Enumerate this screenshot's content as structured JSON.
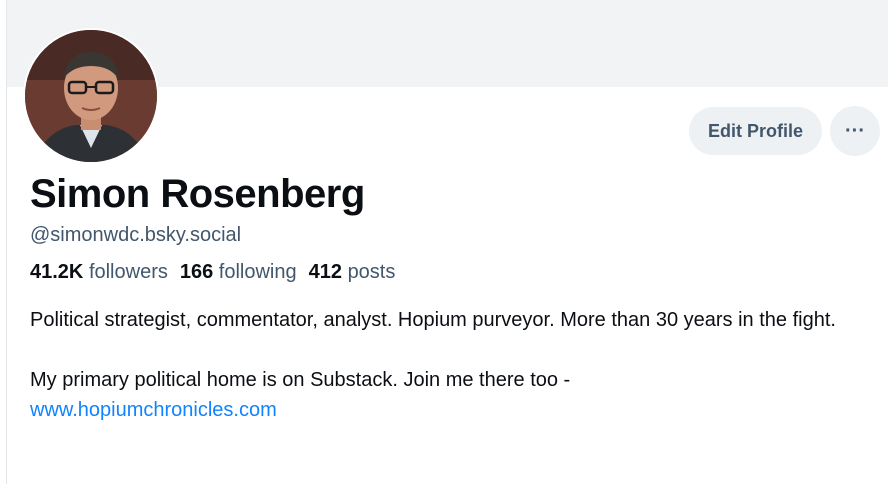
{
  "profile": {
    "display_name": "Simon Rosenberg",
    "handle": "@simonwdc.bsky.social",
    "stats": {
      "followers_count": "41.2K",
      "followers_label": "followers",
      "following_count": "166",
      "following_label": "following",
      "posts_count": "412",
      "posts_label": "posts"
    },
    "bio": {
      "line1": "Political strategist, commentator, analyst.  Hopium purveyor.  More than 30 years in the fight.",
      "line2": "My primary political home is on Substack.  Join me there too -",
      "link": "www.hopiumchronicles.com"
    }
  },
  "actions": {
    "edit_label": "Edit Profile",
    "more_label": "···"
  },
  "colors": {
    "accent_link": "#1083fe",
    "muted_text": "#42576c",
    "button_bg": "#eef1f4",
    "banner_bg": "#f1f3f5"
  }
}
